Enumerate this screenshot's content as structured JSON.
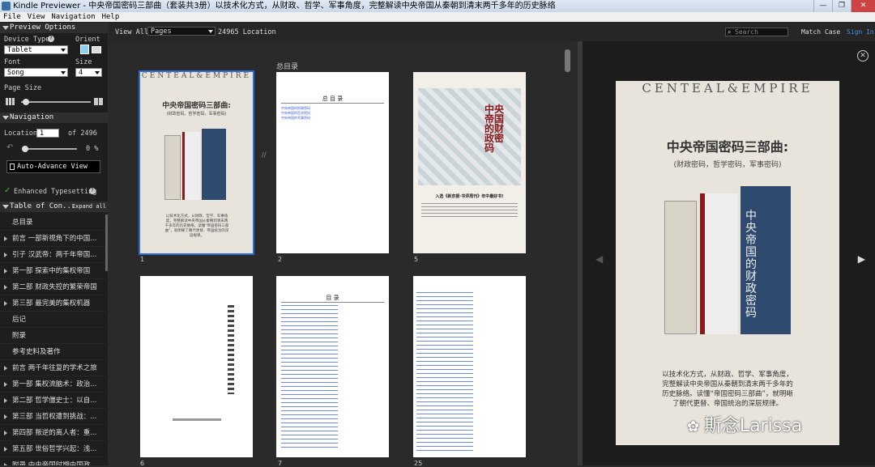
{
  "window": {
    "title": "Kindle Previewer - 中央帝国密码三部曲（套装共3册）以技术化方式，从财政、哲学、军事角度，完整解读中央帝国从秦朝到清末两千多年的历史脉络",
    "controls": [
      "—",
      "❐",
      "✕"
    ]
  },
  "menu": [
    "File",
    "View",
    "Navigation",
    "Help"
  ],
  "sidebar": {
    "preview_options": "Preview Options",
    "device_type_label": "Device Type",
    "orient_label": "Orient",
    "device_type_value": "Tablet",
    "font_label": "Font",
    "font_value": "Song",
    "size_label": "Size",
    "size_value": "4",
    "page_size_label": "Page Size",
    "navigation": "Navigation",
    "location_label": "Location",
    "location_value": "1",
    "location_of": "of 2496",
    "progress_text": "0 %",
    "progress": 0,
    "auto_advance": "Auto-Advance View",
    "enhanced_typesetting": "Enhanced Typesetting",
    "toc_head": "Table of Con...",
    "expand_all": "Expand all",
    "toc": [
      {
        "label": "总目录",
        "arrow": false
      },
      {
        "label": "前言 一部新视角下的中国...",
        "arrow": true
      },
      {
        "label": "引子 汉武帝：两千年帝国...",
        "arrow": true
      },
      {
        "label": "第一部 探索中的集权帝国",
        "arrow": true
      },
      {
        "label": "第二部 财政失控的繁荣帝国",
        "arrow": true
      },
      {
        "label": "第三部 最完美的集权机器",
        "arrow": true
      },
      {
        "label": "后记",
        "arrow": false
      },
      {
        "label": "附录",
        "arrow": false
      },
      {
        "label": "参考史料及著作",
        "arrow": false
      },
      {
        "label": "前言 两千年往复的学术之旅",
        "arrow": true
      },
      {
        "label": "第一部 集权流脑术：政治...",
        "arrow": true
      },
      {
        "label": "第二部 哲学僵史士：以自...",
        "arrow": true
      },
      {
        "label": "第三部 当哲权遭到挑战：...",
        "arrow": true
      },
      {
        "label": "第四部 叛逆的离人者：重...",
        "arrow": true
      },
      {
        "label": "第五部 世俗哲学兴起：浅...",
        "arrow": true
      },
      {
        "label": "附录 中央帝国时期中国政...",
        "arrow": true
      }
    ]
  },
  "toolbar": {
    "view_all": "View All",
    "pages_value": "Pages",
    "location_count": "24965 Location",
    "search_placeholder": "Search",
    "match_case": "Match Case",
    "sign_in": "Sign In"
  },
  "main": {
    "section_label": "总目录",
    "pages": [
      {
        "num": "1"
      },
      {
        "num": "2"
      },
      {
        "num": "5"
      },
      {
        "num": "6"
      },
      {
        "num": "7"
      },
      {
        "num": "25"
      }
    ],
    "toc_title": "总 目 录",
    "toc_links": [
      "中央帝国的财政密码",
      "中央帝国的哲学密码",
      "中央帝国的军事密码"
    ],
    "mulu_title": "目 录"
  },
  "book": {
    "brand": "CENTEAL&EMPIRE",
    "title": "中央帝国密码三部曲:",
    "subtitle": "(财政密码，哲学密码，军事密码)",
    "blurb": "以技术化方式，从财政、哲学、军事角度，完整解读中央帝国从秦朝到清末两千多年的历史脉络。读懂“帝国密码三部曲”，就明晰了朝代更替、帝国统治的深层规律。",
    "side_title": "中央帝国的财政密码",
    "side_sub": "入选《新京报·书评周刊》年中最好书!",
    "vert_title": "中央帝国的财政密码"
  },
  "watermark": "斯念Larissa",
  "colors": {
    "accent": "#2b6fd6",
    "link": "#3a5bd0",
    "check": "#3fbf3f"
  }
}
